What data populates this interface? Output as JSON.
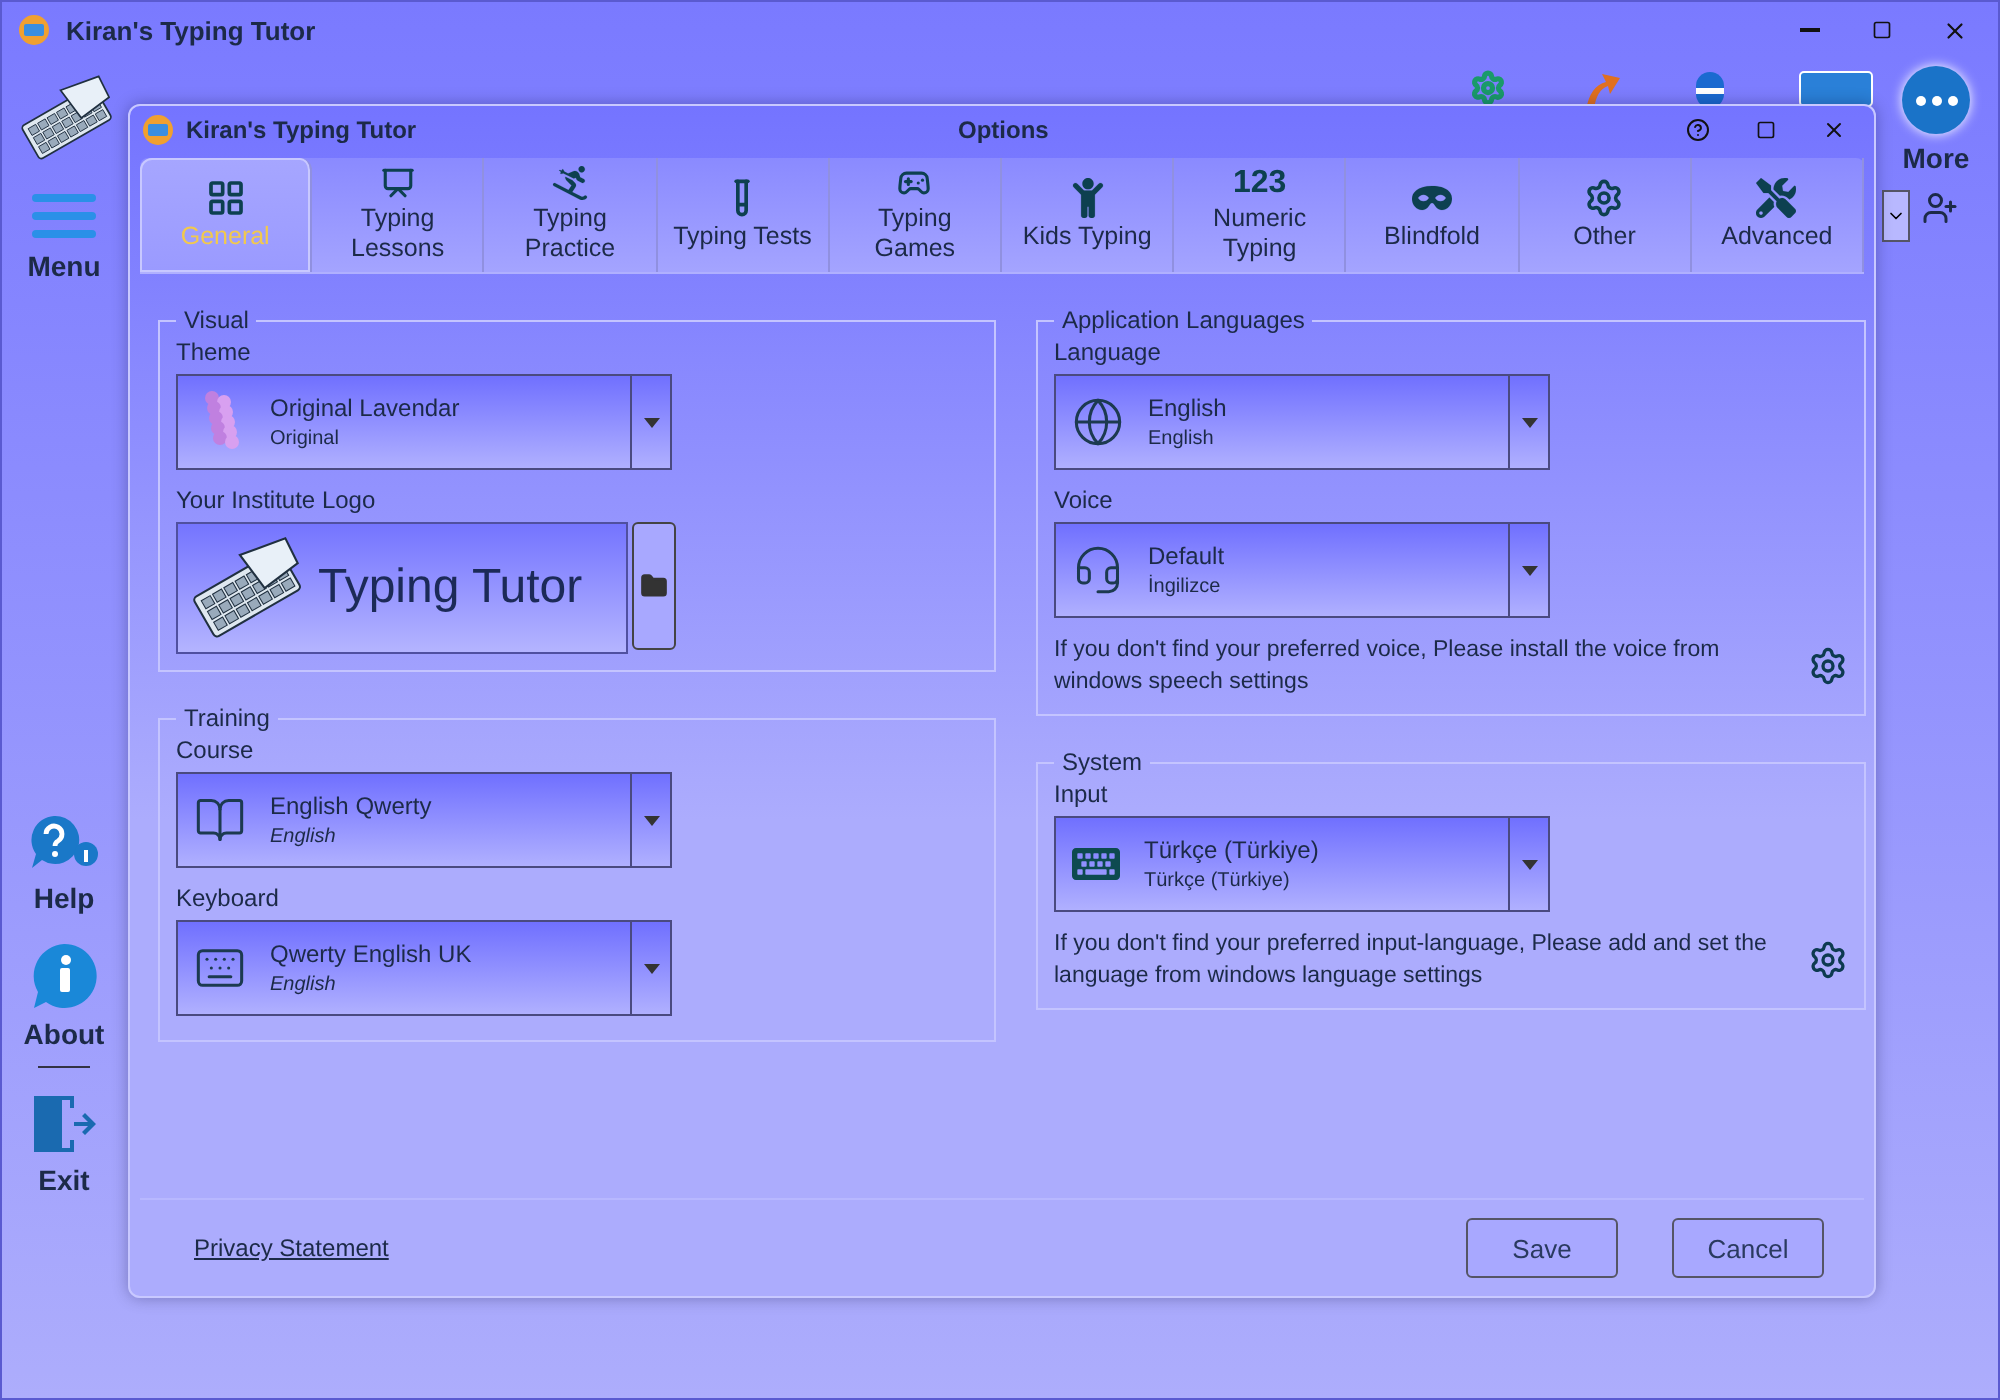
{
  "window": {
    "title": "Kiran's Typing Tutor"
  },
  "sidebar": {
    "items": [
      {
        "kind": "menu",
        "label": "Menu"
      },
      {
        "kind": "help",
        "label": "Help"
      },
      {
        "kind": "about",
        "label": "About"
      },
      {
        "kind": "exit",
        "label": "Exit"
      }
    ]
  },
  "more": {
    "label": "More"
  },
  "dialog": {
    "app_name": "Kiran's Typing Tutor",
    "title": "Options",
    "tabs": [
      {
        "label": "General",
        "selected": true
      },
      {
        "label": "Typing\nLessons",
        "selected": false
      },
      {
        "label": "Typing\nPractice",
        "selected": false
      },
      {
        "label": "Typing Tests",
        "selected": false
      },
      {
        "label": "Typing\nGames",
        "selected": false
      },
      {
        "label": "Kids Typing",
        "selected": false
      },
      {
        "label": "Numeric\nTyping",
        "icon_text": "123",
        "selected": false
      },
      {
        "label": "Blindfold",
        "selected": false
      },
      {
        "label": "Other",
        "selected": false
      },
      {
        "label": "Advanced",
        "selected": false
      }
    ],
    "columns": [
      [
        {
          "title": "Visual",
          "fields": [
            {
              "kind": "theme",
              "label": "Theme",
              "value": "Original Lavendar",
              "detail": "Original"
            },
            {
              "kind": "logo",
              "label": "Your Institute Logo",
              "value": "Typing Tutor"
            }
          ]
        },
        {
          "title": "Training",
          "fields": [
            {
              "kind": "course",
              "label": "Course",
              "value": "English Qwerty",
              "detail": "English"
            },
            {
              "kind": "keyboard",
              "label": "Keyboard",
              "value": "Qwerty English UK",
              "detail": "English"
            }
          ]
        }
      ],
      [
        {
          "title": "Application Languages",
          "fields": [
            {
              "kind": "language",
              "label": "Language",
              "value": "English",
              "detail": "English"
            },
            {
              "kind": "voice",
              "label": "Voice",
              "value": "Default",
              "detail": "İngilizce"
            }
          ],
          "note": "If you don't find your preferred voice, Please install the voice from windows speech settings"
        },
        {
          "title": "System",
          "fields": [
            {
              "kind": "input",
              "label": "Input",
              "value": "Türkçe (Türkiye)",
              "detail": "Türkçe (Türkiye)"
            }
          ],
          "note": "If you don't find your preferred input-language, Please add and set the language from windows language settings"
        }
      ]
    ],
    "footer": {
      "link": "Privacy Statement",
      "buttons": [
        "Save",
        "Cancel"
      ]
    }
  }
}
